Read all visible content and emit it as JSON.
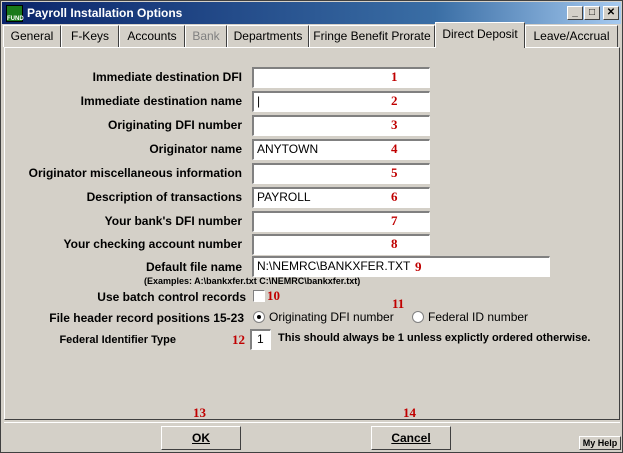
{
  "window": {
    "title": "Payroll Installation Options",
    "app_icon_text": "FUND"
  },
  "titlebar_buttons": {
    "minimize": "_",
    "maximize": "□",
    "close": "✕"
  },
  "tabs": [
    {
      "label": "General"
    },
    {
      "label": "F-Keys"
    },
    {
      "label": "Accounts"
    },
    {
      "label": "Bank",
      "disabled": true
    },
    {
      "label": "Departments"
    },
    {
      "label": "Fringe Benefit Prorate"
    },
    {
      "label": "Direct Deposit",
      "active": true
    },
    {
      "label": "Leave/Accrual"
    }
  ],
  "form": {
    "immediate_dest_dfi": {
      "label": "Immediate destination DFI",
      "value": "",
      "marker": "1"
    },
    "immediate_dest_name": {
      "label": "Immediate destination name",
      "value": "|",
      "marker": "2"
    },
    "originating_dfi": {
      "label": "Originating DFI number",
      "value": "",
      "marker": "3"
    },
    "originator_name": {
      "label": "Originator name",
      "value": "ANYTOWN",
      "marker": "4"
    },
    "originator_misc": {
      "label": "Originator miscellaneous information",
      "value": "",
      "marker": "5"
    },
    "description": {
      "label": "Description of transactions",
      "value": "PAYROLL",
      "marker": "6"
    },
    "bank_dfi": {
      "label": "Your bank's DFI number",
      "value": "",
      "marker": "7"
    },
    "checking_account": {
      "label": "Your checking account number",
      "value": "",
      "marker": "8"
    },
    "default_file": {
      "label": "Default file name",
      "value": "N:\\NEMRC\\BANKXFER.TXT",
      "marker": "9",
      "examples": "(Examples:  A:\\bankxfer.txt  C:\\NEMRC\\bankxfer.txt)"
    },
    "batch_control": {
      "label": "Use batch control records",
      "checked": false,
      "marker": "10"
    },
    "file_header": {
      "label": "File header record positions 15-23",
      "marker": "11",
      "options": [
        "Originating DFI number",
        "Federal ID number"
      ],
      "selected": "Originating DFI number"
    },
    "federal_identifier": {
      "label": "Federal Identifier Type",
      "value": "1",
      "marker": "12",
      "note": "This should always be 1 unless explictly ordered otherwise."
    }
  },
  "buttons": {
    "ok": {
      "label": "OK",
      "marker": "13"
    },
    "cancel": {
      "label": "Cancel",
      "marker": "14"
    },
    "help": {
      "label": "My Help"
    }
  }
}
